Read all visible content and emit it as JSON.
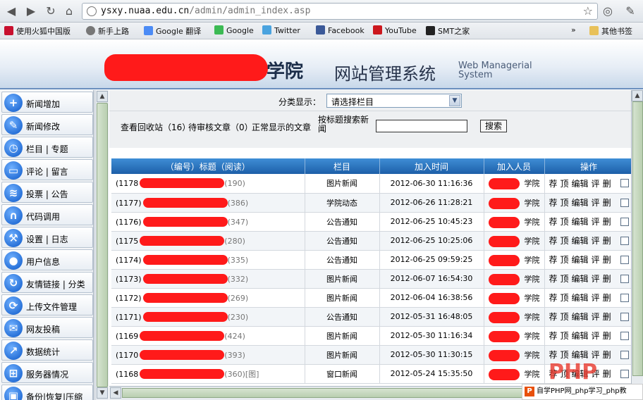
{
  "browser": {
    "url_host": "ysxy.nuaa.edu.cn",
    "url_path": "/admin/admin_index.asp",
    "bookmarks": [
      "使用火狐中国版",
      "新手上路",
      "Google 翻译",
      "Google",
      "Twitter",
      "Facebook",
      "YouTube",
      "SMT之家"
    ],
    "other_bookmarks": "其他书签",
    "overflow": "»"
  },
  "banner": {
    "college_suffix": "学院",
    "system_name": "网站管理系统",
    "system_name_en_1": "Web Managerial",
    "system_name_en_2": "System"
  },
  "sidebar": {
    "items": [
      {
        "label": "新闻增加",
        "icon": "plus-icon"
      },
      {
        "label": "新闻修改",
        "icon": "edit-icon"
      },
      {
        "label": "栏目 | 专题",
        "icon": "clock-icon"
      },
      {
        "label": "评论 | 留言",
        "icon": "chat-icon"
      },
      {
        "label": "投票 | 公告",
        "icon": "rss-icon"
      },
      {
        "label": "代码调用",
        "icon": "headset-icon"
      },
      {
        "label": "设置 | 日志",
        "icon": "wrench-icon"
      },
      {
        "label": "用户信息",
        "icon": "user-icon"
      },
      {
        "label": "友情链接 | 分类",
        "icon": "link-icon"
      },
      {
        "label": "上传文件管理",
        "icon": "upload-icon"
      },
      {
        "label": "网友投稿",
        "icon": "mail-icon"
      },
      {
        "label": "数据统计",
        "icon": "chart-icon"
      },
      {
        "label": "服务器情况",
        "icon": "windows-icon"
      },
      {
        "label": "备份|恢复|压缩",
        "icon": "lock-icon"
      }
    ]
  },
  "filter": {
    "label": "分类显示：",
    "selected": "请选择栏目"
  },
  "links": {
    "recycle": "查看回收站（16）",
    "pending": "待审核文章（0）",
    "normal": "正常显示的文章",
    "search_label": "按标题搜索新闻",
    "search_button": "搜索"
  },
  "table": {
    "headers": [
      "（编号）标题（阅读）",
      "栏目",
      "加入时间",
      "加入人员",
      "操作"
    ],
    "rows": [
      {
        "id": "(1178",
        "reads": "(190)",
        "column": "图片新闻",
        "time": "2012-06-30 11:16:36",
        "adder_suffix": "学院"
      },
      {
        "id": "(1177)",
        "reads": "(386)",
        "column": "学院动态",
        "time": "2012-06-26 11:28:21",
        "adder_suffix": "学院"
      },
      {
        "id": "(1176)",
        "reads": "(347)",
        "column": "公告通知",
        "time": "2012-06-25 10:45:23",
        "adder_suffix": "学院"
      },
      {
        "id": "(1175",
        "reads": "(280)",
        "column": "公告通知",
        "time": "2012-06-25 10:25:06",
        "adder_suffix": "学院"
      },
      {
        "id": "(1174)",
        "reads": "(335)",
        "column": "公告通知",
        "time": "2012-06-25 09:59:25",
        "adder_suffix": "学院"
      },
      {
        "id": "(1173)",
        "reads": "(332)",
        "column": "图片新闻",
        "time": "2012-06-07 16:54:30",
        "adder_suffix": "学院"
      },
      {
        "id": "(1172)",
        "reads": "(269)",
        "column": "图片新闻",
        "time": "2012-06-04 16:38:56",
        "adder_suffix": "学院"
      },
      {
        "id": "(1171)",
        "reads": "(230)",
        "column": "公告通知",
        "time": "2012-05-31 16:48:05",
        "adder_suffix": "学院"
      },
      {
        "id": "(1169",
        "reads": "(424)",
        "column": "图片新闻",
        "time": "2012-05-30 11:16:34",
        "adder_suffix": "学院"
      },
      {
        "id": "(1170",
        "reads": "(393)",
        "column": "图片新闻",
        "time": "2012-05-30 11:30:15",
        "adder_suffix": "学院"
      },
      {
        "id": "(1168",
        "reads": "(360)[图]",
        "column": "窗口新闻",
        "time": "2012-05-24 15:35:50",
        "adder_suffix": "学院"
      }
    ],
    "ops": [
      "荐",
      "顶",
      "编辑",
      "评",
      "删"
    ]
  },
  "watermark": {
    "text": "自学PHP网_php学习_php教"
  },
  "colors": {
    "header_blue": "#1d5fa8",
    "redaction": "#ff1a1a"
  }
}
